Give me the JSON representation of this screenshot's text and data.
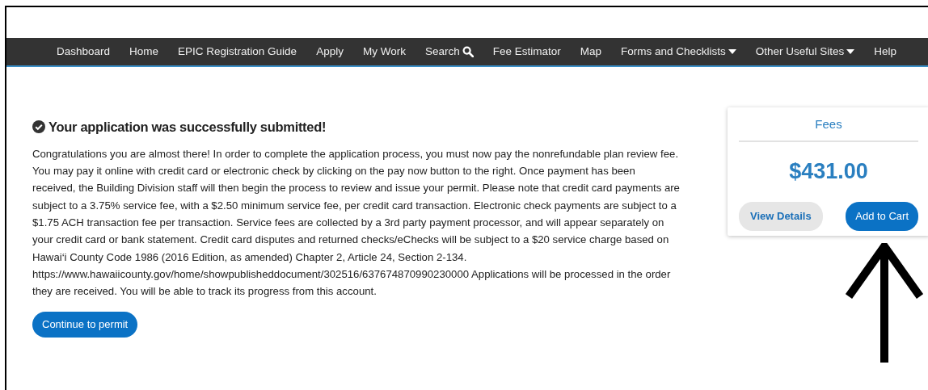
{
  "navbar": {
    "items": [
      {
        "label": "Dashboard",
        "kind": "link"
      },
      {
        "label": "Home",
        "kind": "link"
      },
      {
        "label": "EPIC Registration Guide",
        "kind": "link"
      },
      {
        "label": "Apply",
        "kind": "link"
      },
      {
        "label": "My Work",
        "kind": "link"
      },
      {
        "label": "Search",
        "kind": "search"
      },
      {
        "label": "Fee Estimator",
        "kind": "link"
      },
      {
        "label": "Map",
        "kind": "link"
      },
      {
        "label": "Forms and Checklists",
        "kind": "dropdown"
      },
      {
        "label": "Other Useful Sites",
        "kind": "dropdown"
      },
      {
        "label": "Help",
        "kind": "link"
      }
    ]
  },
  "message": {
    "title": "Your application was successfully submitted!",
    "body": "Congratulations you are almost there! In order to complete the application process, you must now pay the nonrefundable plan review fee. You may pay it online with credit card or electronic check by clicking on the pay now button to the right. Once payment has been received, the Building Division staff will then begin the process to review and issue your permit. Please note that credit card payments are subject to a 3.75% service fee, with a $2.50 minimum service fee, per credit card transaction. Electronic check payments are subject to a $1.75 ACH transaction fee per transaction. Service fees are collected by a 3rd party payment processor, and will appear separately on your credit card or bank statement. Credit card disputes and returned checks/eChecks will be subject to a $20 service charge based on Hawai‘i County Code 1986 (2016 Edition, as amended) Chapter 2, Article 24, Section 2-134. https://www.hawaiicounty.gov/home/showpublisheddocument/302516/637674870990230000 Applications will be processed in the order they are received. You will be able to track its progress from this account.",
    "button": "Continue to permit"
  },
  "fees": {
    "title": "Fees",
    "amount": "$431.00",
    "buttons": [
      {
        "label": "View Details",
        "kind": "secondary"
      },
      {
        "label": "Add to Cart",
        "kind": "primary"
      }
    ]
  }
}
